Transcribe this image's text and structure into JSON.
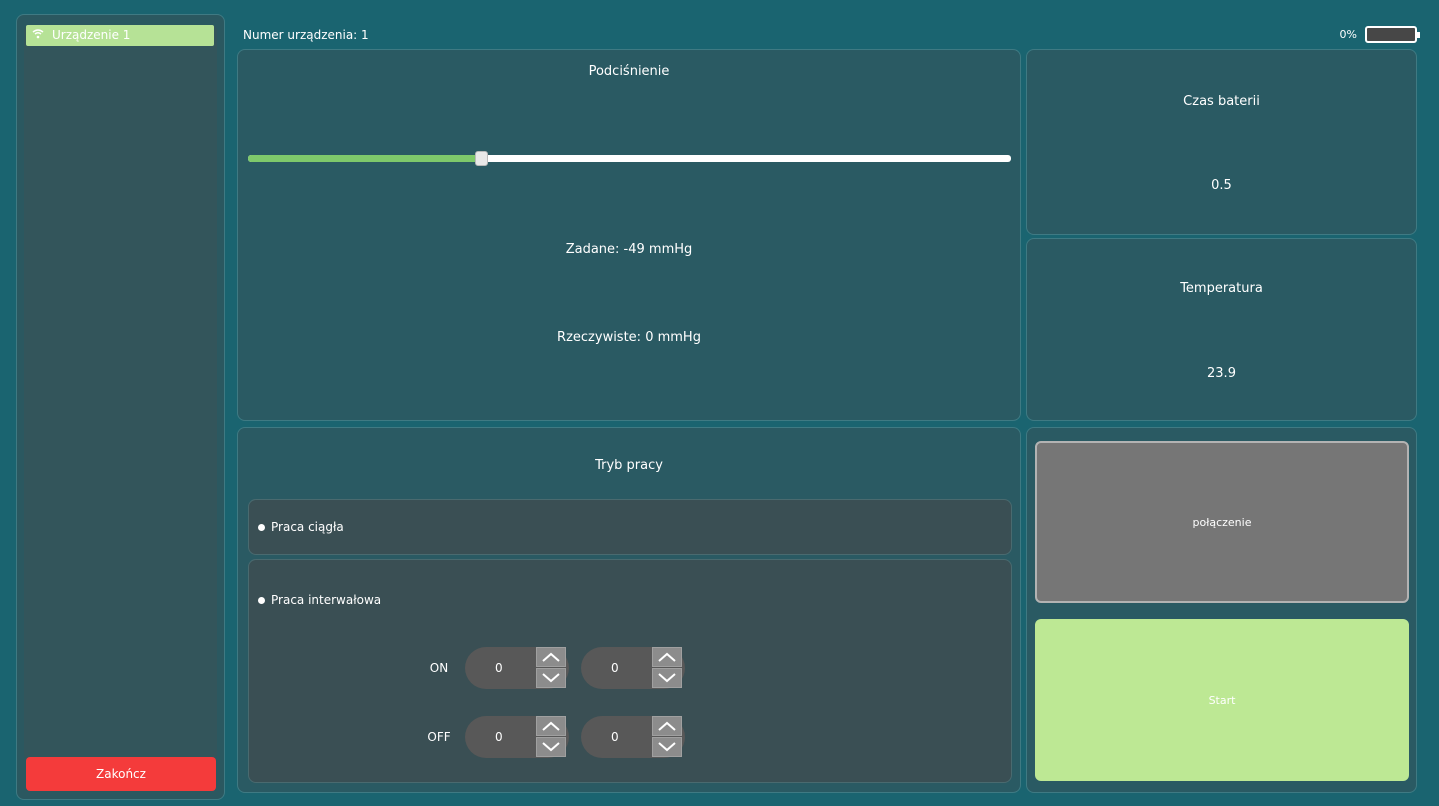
{
  "sidebar": {
    "device_item": "Urządzenie 1",
    "close_button": "Zakończ"
  },
  "header": {
    "device_number_label": "Numer urządzenia: 1",
    "battery_percent": "0%",
    "battery_level": 0
  },
  "pressure_panel": {
    "title": "Podciśnienie",
    "slider_fraction": 0.305,
    "set_label": "Zadane: -49  mmHg",
    "current_label": "Rzeczywiste: 0  mmHg"
  },
  "sensor_panel": {
    "title": "Czas baterii",
    "value": "0.5"
  },
  "temperature_panel": {
    "title": "Temperatura",
    "value": "23.9"
  },
  "mode_panel": {
    "title": "Tryb pracy",
    "continuous_label": "Praca ciągła",
    "interval_label": "Praca interwałowa",
    "on_label": "ON",
    "off_label": "OFF",
    "on_min": "0",
    "on_sec": "0",
    "off_min": "0",
    "off_sec": "0"
  },
  "actions": {
    "connect_label": "połączenie",
    "start_label": "Start",
    "connect_color": "#767676",
    "start_color": "#bde894"
  }
}
